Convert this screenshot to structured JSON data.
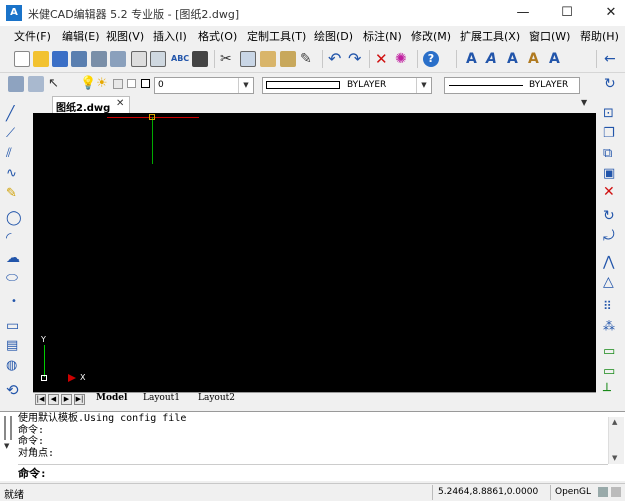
{
  "window": {
    "title": "米健CAD编辑器 5.2 专业版 - [图纸2.dwg]",
    "app_icon": "A",
    "minimize": "—",
    "maximize": "☐",
    "close": "✕"
  },
  "menu": [
    {
      "label": "文件(F)"
    },
    {
      "label": "编辑(E)"
    },
    {
      "label": "视图(V)"
    },
    {
      "label": "插入(I)"
    },
    {
      "label": "格式(O)"
    },
    {
      "label": "定制工具(T)"
    },
    {
      "label": "绘图(D)"
    },
    {
      "label": "标注(N)"
    },
    {
      "label": "修改(M)"
    },
    {
      "label": "扩展工具(X)"
    },
    {
      "label": "窗口(W)"
    },
    {
      "label": "帮助(H)"
    }
  ],
  "layer": {
    "current": "0",
    "color_value": "BYLAYER",
    "linetype_value": "BYLAYER"
  },
  "document": {
    "tab_label": "图纸2.dwg",
    "tab_close": "✕"
  },
  "layout_tabs": [
    "Model",
    "Layout1",
    "Layout2"
  ],
  "nav": [
    "|◀",
    "◀",
    "▶",
    "▶|"
  ],
  "ucs": {
    "y": "Y",
    "x": "X"
  },
  "command": {
    "history": [
      "使用默认模板.Using config file",
      "命令:",
      "命令:",
      "对角点:"
    ],
    "prompt": "命令:"
  },
  "status": {
    "left": "就绪",
    "coords": "5.2464,8.8861,0.0000",
    "renderer": "OpenGL"
  },
  "colors": {
    "canvas": "#000000",
    "crosshair_h": "#cc0000",
    "crosshair_v": "#00aa00",
    "accent": "#1a73c9"
  }
}
